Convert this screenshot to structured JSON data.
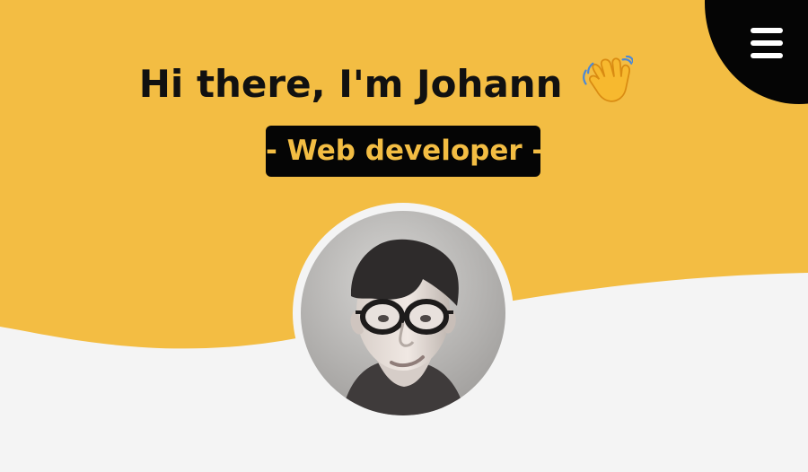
{
  "hero": {
    "greeting": "Hi there, I'm Johann",
    "role": "- Web developer -"
  },
  "icons": {
    "menu": "hamburger-menu-icon",
    "wave": "waving-hand-icon"
  },
  "colors": {
    "primary": "#f3bd43",
    "dark": "#050505",
    "background": "#f4f4f4"
  },
  "profile": {
    "photo": "portrait-photo"
  }
}
